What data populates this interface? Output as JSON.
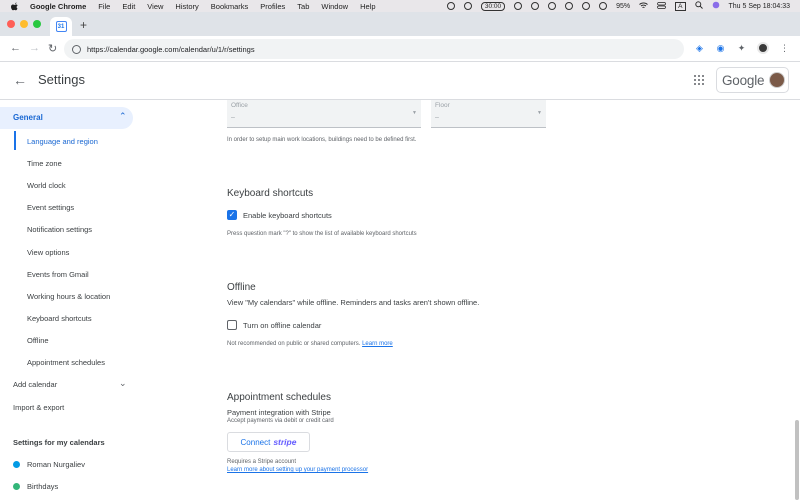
{
  "menubar": {
    "app": "Google Chrome",
    "items": [
      "File",
      "Edit",
      "View",
      "History",
      "Bookmarks",
      "Profiles",
      "Tab",
      "Window",
      "Help"
    ],
    "timer": "30:00",
    "battery": "95%",
    "input_source": "A",
    "datetime": "Thu 5 Sep  18:04:33"
  },
  "browser": {
    "url": "https://calendar.google.com/calendar/u/1/r/settings"
  },
  "header": {
    "title": "Settings",
    "google_label": "Google"
  },
  "sidebar": {
    "general_label": "General",
    "general_items": [
      "Language and region",
      "Time zone",
      "World clock",
      "Event settings",
      "Notification settings",
      "View options",
      "Events from Gmail",
      "Working hours & location",
      "Keyboard shortcuts",
      "Offline",
      "Appointment schedules"
    ],
    "add_calendar": "Add calendar",
    "import_export": "Import & export",
    "my_calendars_heading": "Settings for my calendars",
    "calendars": [
      {
        "name": "Roman Nurgaliev",
        "color": "#039be5"
      },
      {
        "name": "Birthdays",
        "color": "#33b679"
      }
    ]
  },
  "main": {
    "office_field": {
      "label": "Office",
      "value": "–"
    },
    "floor_field": {
      "label": "Floor",
      "value": "–"
    },
    "buildings_note": "In order to setup main work locations, buildings need to be defined first.",
    "keyboard": {
      "title": "Keyboard shortcuts",
      "checkbox_label": "Enable keyboard shortcuts",
      "checked": true,
      "note": "Press question mark \"?\" to show the list of available keyboard shortcuts"
    },
    "offline": {
      "title": "Offline",
      "description": "View \"My calendars\" while offline. Reminders and tasks aren't shown offline.",
      "checkbox_label": "Turn on offline calendar",
      "checked": false,
      "note": "Not recommended on public or shared computers.",
      "learn_more": "Learn more"
    },
    "appointments": {
      "title": "Appointment schedules",
      "subtitle": "Payment integration with Stripe",
      "subnote": "Accept payments via debit or credit card",
      "connect_label": "Connect",
      "stripe_label": "stripe",
      "requires": "Requires a Stripe account",
      "learn_link": "Learn more about setting up your payment processor"
    }
  },
  "colors": {
    "accent": "#1a73e8",
    "active_bg": "#e8f0fe",
    "stripe": "#635bff"
  }
}
